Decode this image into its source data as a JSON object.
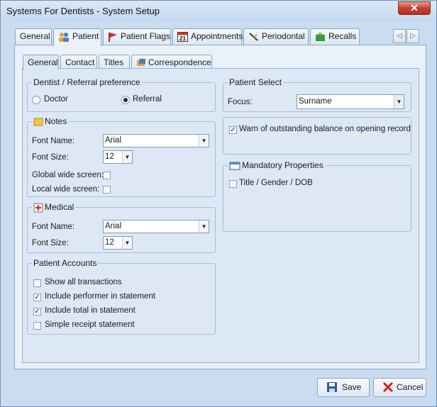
{
  "window": {
    "title": "Systems For Dentists - System Setup",
    "close_symbol": "✕"
  },
  "outer_tabs": [
    {
      "label": "General",
      "icon": "none",
      "active": false
    },
    {
      "label": "Patient",
      "icon": "people-icon",
      "active": true
    },
    {
      "label": "Patient Flags",
      "icon": "flag-icon",
      "active": false
    },
    {
      "label": "Appointments",
      "icon": "calendar-icon",
      "active": false
    },
    {
      "label": "Periodontal",
      "icon": "tooth-icon",
      "active": false
    },
    {
      "label": "Recalls",
      "icon": "recall-icon",
      "active": false
    }
  ],
  "calendar_icon_text": "21",
  "tab_nav": {
    "prev": "◁",
    "next": "▷"
  },
  "inner_tabs": [
    {
      "label": "General",
      "active": true
    },
    {
      "label": "Contact",
      "active": false
    },
    {
      "label": "Titles",
      "active": false
    },
    {
      "label": "Correspondence",
      "icon": "correspondence-icon",
      "active": false
    }
  ],
  "dentist_pref": {
    "title": "Dentist / Referral preference",
    "options": [
      {
        "label": "Doctor",
        "selected": false
      },
      {
        "label": "Referral",
        "selected": true
      }
    ]
  },
  "notes": {
    "title": "Notes",
    "font_name_label": "Font Name:",
    "font_name_value": "Arial",
    "font_size_label": "Font Size:",
    "font_size_value": "12",
    "global_wide_label": "Global wide screen:",
    "global_wide_checked": false,
    "local_wide_label": "Local wide screen:",
    "local_wide_checked": false
  },
  "medical": {
    "title": "Medical",
    "font_name_label": "Font Name:",
    "font_name_value": "Arial",
    "font_size_label": "Font Size:",
    "font_size_value": "12"
  },
  "accounts": {
    "title": "Patient Accounts",
    "items": [
      {
        "label": "Show all transactions",
        "checked": false
      },
      {
        "label": "Include performer in statement",
        "checked": true
      },
      {
        "label": "Include total in statement",
        "checked": true
      },
      {
        "label": "Simple receipt statement",
        "checked": false
      }
    ]
  },
  "patient_select": {
    "title": "Patient Select",
    "focus_label": "Focus:",
    "focus_value": "Surname"
  },
  "warn": {
    "label": "Warn of outstanding balance on opening record",
    "checked": true
  },
  "mandatory": {
    "title": "Mandatory Properties",
    "items": [
      {
        "label": "Title / Gender / DOB",
        "checked": false
      }
    ]
  },
  "check_mark": "✓",
  "dropdown_arrow": "▼",
  "buttons": {
    "save": "Save",
    "cancel": "Cancel"
  }
}
